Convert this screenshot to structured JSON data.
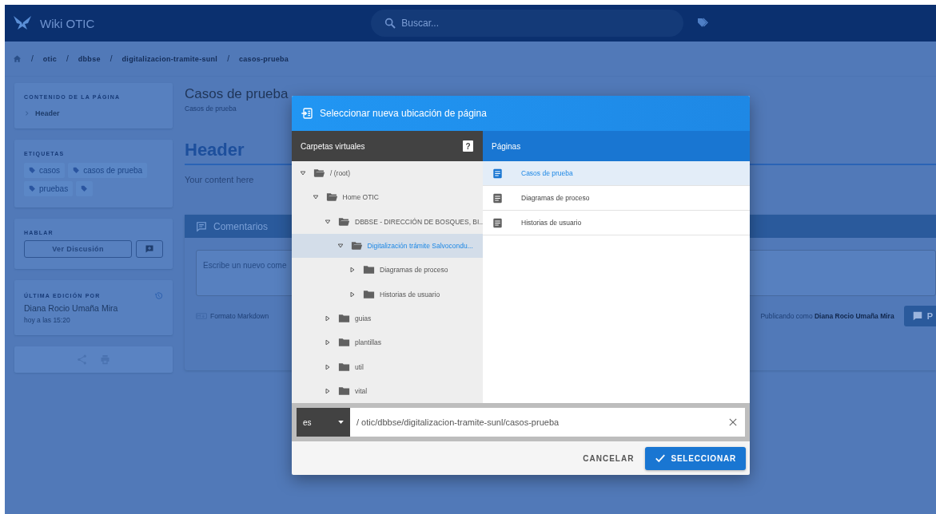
{
  "topbar": {
    "title": "Wiki OTIC",
    "search": {
      "placeholder": "Buscar..."
    }
  },
  "breadcrumb": {
    "separator": "/",
    "items": [
      "otic",
      "dbbse",
      "digitalizacion-tramite-sunl",
      "casos-prueba"
    ]
  },
  "sidebar": {
    "toc": {
      "heading": "CONTENIDO DE LA PÁGINA",
      "items": [
        "Header"
      ]
    },
    "tags": {
      "heading": "ETIQUETAS",
      "items": [
        "casos",
        "casos de prueba",
        "pruebas"
      ]
    },
    "talk": {
      "heading": "HABLAR",
      "button": "Ver Discusión"
    },
    "last_edit": {
      "heading": "ÚLTIMA EDICIÓN POR",
      "author": "Diana Rocio Umaña Mira",
      "time": "hoy a las 15:20"
    }
  },
  "page": {
    "title": "Casos de prueba",
    "subtitle": "Casos de prueba",
    "heading": "Header",
    "body": "Your content here"
  },
  "comments": {
    "title": "Comentarios",
    "placeholder": "Escribe un nuevo come",
    "format": "Formato Markdown",
    "posting_as": "Publicando como **Diana Rocio Umaña Mira**",
    "post_button": "P"
  },
  "dialog": {
    "title": "Seleccionar nueva ubicación de página",
    "folders_header": "Carpetas virtuales",
    "help": "?",
    "pages_header": "Páginas",
    "tree": [
      {
        "label": "/ (root)",
        "expanded": true,
        "selected": false,
        "children": [
          {
            "label": "Home OTIC",
            "expanded": true,
            "selected": false,
            "children": [
              {
                "label": "DBBSE - DIRECCIÓN DE BOSQUES, BI...",
                "expanded": true,
                "selected": false,
                "children": [
                  {
                    "label": "Digitalización trámite Salvocondu...",
                    "expanded": true,
                    "selected": true,
                    "children": [
                      {
                        "label": "Diagramas de proceso",
                        "expanded": false,
                        "selected": false
                      },
                      {
                        "label": "Historias de usuario",
                        "expanded": false,
                        "selected": false
                      }
                    ]
                  }
                ]
              },
              {
                "label": "guias",
                "expanded": false,
                "selected": false
              },
              {
                "label": "plantillas",
                "expanded": false,
                "selected": false
              },
              {
                "label": "util",
                "expanded": false,
                "selected": false
              },
              {
                "label": "vital",
                "expanded": false,
                "selected": false
              }
            ]
          }
        ]
      }
    ],
    "pages": [
      {
        "label": "Casos de prueba",
        "selected": true
      },
      {
        "label": "Diagramas de proceso",
        "selected": false
      },
      {
        "label": "Historias de usuario",
        "selected": false
      }
    ],
    "locale": "es",
    "path": "/ otic/dbbse/digitalizacion-tramite-sunl/casos-prueba",
    "buttons": {
      "cancel": "CANCELAR",
      "confirm": "SELECCIONAR"
    }
  }
}
